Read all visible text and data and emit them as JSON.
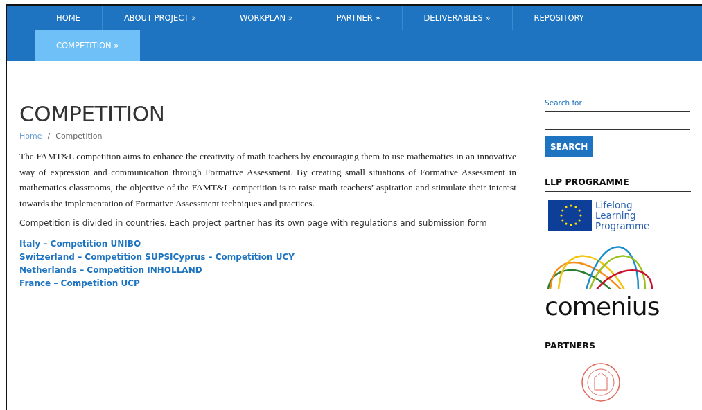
{
  "nav": {
    "items": [
      {
        "label": "HOME",
        "selected": false
      },
      {
        "label": "ABOUT PROJECT »",
        "selected": false
      },
      {
        "label": "WORKPLAN »",
        "selected": false
      },
      {
        "label": "PARTNER »",
        "selected": false
      },
      {
        "label": "DELIVERABLES »",
        "selected": false
      },
      {
        "label": "REPOSITORY",
        "selected": false
      },
      {
        "label": "COMPETITION »",
        "selected": true
      }
    ]
  },
  "page": {
    "title": "COMPETITION",
    "breadcrumb": [
      {
        "label": "Home",
        "kind": "link"
      },
      {
        "label": "/",
        "kind": "separator"
      },
      {
        "label": "Competition",
        "kind": "current"
      }
    ],
    "intro": "The FAMT&L competition aims to enhance the creativity of math teachers by encouraging them to use mathematics in an innovative way of expression and communication through Formative Assessment. By creating small situations of Formative Assessment in mathematics classrooms, the objective of the FAMT&L competition is to raise math teachers’ aspiration and stimulate their interest towards the implementation of Formative Assessment techniques and practices.",
    "note": "Competition is divided in countries. Each project partner has its own page with regulations and submission form",
    "links": [
      "Italy – Competition UNIBO",
      "Switzerland – Competition SUPSICyprus – Competition UCY",
      "Netherlands – Competition INHOLLAND",
      "France – Competition UCP"
    ]
  },
  "sidebar": {
    "search_label": "Search for:",
    "search_button": "SEARCH",
    "llp_heading": "LLP PROGRAMME",
    "llp_logo_text": [
      "Lifelong",
      "Learning",
      "Programme"
    ],
    "comenius_text": "comenius",
    "partners_heading": "PARTNERS"
  }
}
